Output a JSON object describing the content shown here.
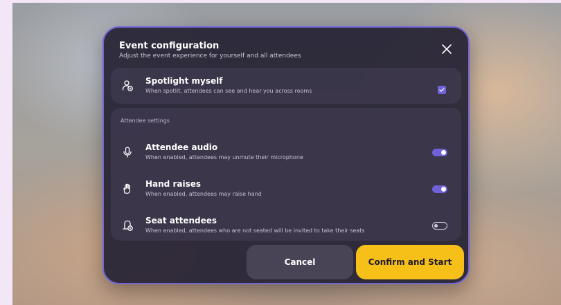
{
  "dialog": {
    "title": "Event configuration",
    "subtitle": "Adjust the event experience for yourself and all attendees",
    "close_icon": "close-icon"
  },
  "spotlight": {
    "title": "Spotlight myself",
    "description": "When spotlit, attendees can see and hear you across rooms",
    "icon": "person-spotlight-icon",
    "checked": true
  },
  "attendee_settings": {
    "label": "Attendee settings",
    "items": [
      {
        "title": "Attendee audio",
        "description": "When enabled, attendees may unmute their microphone",
        "icon": "microphone-icon",
        "enabled": true
      },
      {
        "title": "Hand raises",
        "description": "When enabled, attendees may raise hand",
        "icon": "hand-icon",
        "enabled": true
      },
      {
        "title": "Seat attendees",
        "description": "When enabled, attendees who are not seated will be invited to take their seats",
        "icon": "seat-person-icon",
        "enabled": false
      }
    ]
  },
  "buttons": {
    "cancel": "Cancel",
    "confirm": "Confirm and Start"
  },
  "colors": {
    "accent": "#6f62d8",
    "confirm": "#f6c019",
    "dialog_border": "#7366d9"
  }
}
